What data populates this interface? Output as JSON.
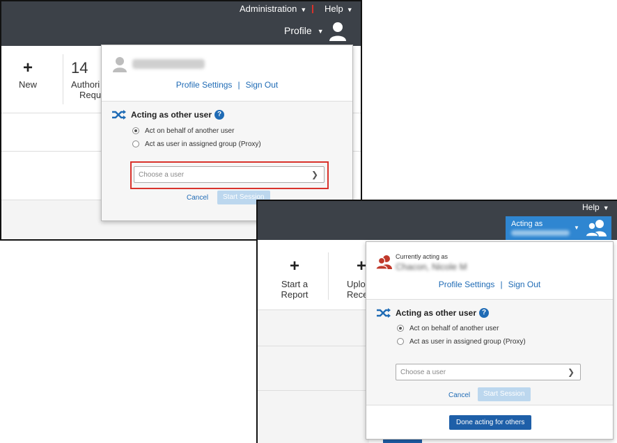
{
  "screenshot1": {
    "header": {
      "administration_label": "Administration",
      "help_label": "Help",
      "profile_label": "Profile"
    },
    "tiles": {
      "new_label": "New",
      "count_partial": "14",
      "auth_line1": "Authori",
      "auth_line2": "Requ"
    },
    "panel": {
      "profile_settings": "Profile Settings",
      "sign_out": "Sign Out",
      "acting_heading": "Acting as other user",
      "help_glyph": "?",
      "option_behalf": "Act on behalf of another user",
      "option_proxy": "Act as user in assigned group (Proxy)",
      "choose_placeholder": "Choose a user",
      "cancel_label": "Cancel",
      "start_label": "Start Session"
    }
  },
  "screenshot2": {
    "header": {
      "help_label": "Help",
      "acting_as_label": "Acting as"
    },
    "tiles": {
      "start_line1": "Start a",
      "start_line2": "Report",
      "upload_line1": "Uplo",
      "upload_line2": "Rece"
    },
    "panel": {
      "currently_acting": "Currently acting as",
      "acting_name": "Chacon, Nicole M",
      "profile_settings": "Profile Settings",
      "sign_out": "Sign Out",
      "acting_heading": "Acting as other user",
      "help_glyph": "?",
      "option_behalf": "Act on behalf of another user",
      "option_proxy": "Act as user in assigned group (Proxy)",
      "choose_placeholder": "Choose a user",
      "cancel_label": "Cancel",
      "start_label": "Start Session",
      "done_label": "Done acting for others"
    }
  },
  "colors": {
    "topbar": "#3c4148",
    "link": "#1f6bb5",
    "highlight_border": "#d9322b",
    "acting_box": "#2f86d1",
    "done_button": "#1e5fa8",
    "start_button_disabled": "#bcd7ee",
    "proxy_icon": "#c0392b"
  },
  "icons": [
    "user-avatar-icon",
    "caret-down-icon",
    "shuffle-icon",
    "help-icon",
    "chevron-down-icon",
    "plus-icon",
    "users-group-icon",
    "proxy-users-icon"
  ]
}
